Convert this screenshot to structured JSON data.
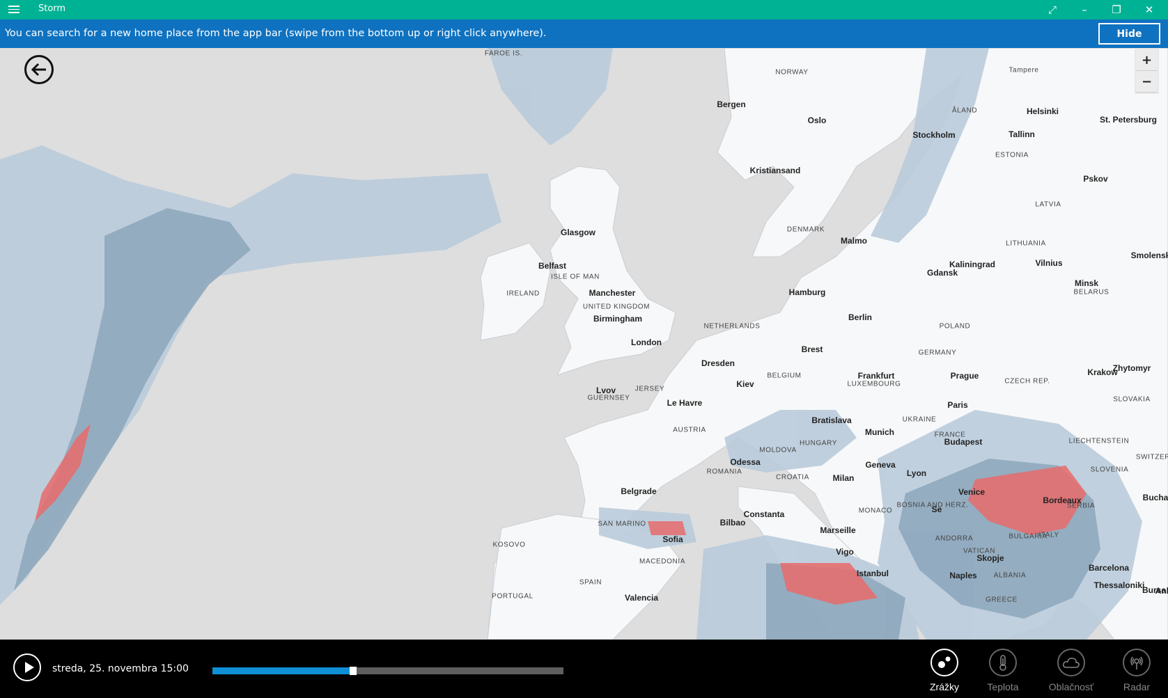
{
  "app": {
    "title": "Storm"
  },
  "banner": {
    "message": "You can search for a new home place from the app bar (swipe from the bottom up or right click anywhere).",
    "hide_label": "Hide"
  },
  "map": {
    "labels": [
      {
        "text": "FAROE IS.",
        "kind": "country"
      },
      {
        "text": "NORWAY",
        "kind": "country"
      },
      {
        "text": "Bergen",
        "kind": "city"
      },
      {
        "text": "Oslo",
        "kind": "city"
      },
      {
        "text": "Stockholm",
        "kind": "city"
      },
      {
        "text": "Tampere",
        "kind": "country"
      },
      {
        "text": "ÅLAND",
        "kind": "country"
      },
      {
        "text": "Helsinki",
        "kind": "city"
      },
      {
        "text": "St. Petersburg",
        "kind": "city"
      },
      {
        "text": "Tallinn",
        "kind": "city"
      },
      {
        "text": "ESTONIA",
        "kind": "country"
      },
      {
        "text": "Kristiansand",
        "kind": "city"
      },
      {
        "text": "Pskov",
        "kind": "city"
      },
      {
        "text": "LATVIA",
        "kind": "country"
      },
      {
        "text": "DENMARK",
        "kind": "country"
      },
      {
        "text": "Malmo",
        "kind": "city"
      },
      {
        "text": "LITHUANIA",
        "kind": "country"
      },
      {
        "text": "Kaliningrad",
        "kind": "city"
      },
      {
        "text": "Vilnius",
        "kind": "city"
      },
      {
        "text": "Smolensk",
        "kind": "city"
      },
      {
        "text": "Gdansk",
        "kind": "city"
      },
      {
        "text": "Glasgow",
        "kind": "city"
      },
      {
        "text": "Belfast",
        "kind": "city"
      },
      {
        "text": "ISLE OF MAN",
        "kind": "country"
      },
      {
        "text": "IRELAND",
        "kind": "country"
      },
      {
        "text": "Manchester",
        "kind": "city"
      },
      {
        "text": "UNITED KINGDOM",
        "kind": "country"
      },
      {
        "text": "Birmingham",
        "kind": "city"
      },
      {
        "text": "London",
        "kind": "city"
      },
      {
        "text": "Hamburg",
        "kind": "city"
      },
      {
        "text": "Berlin",
        "kind": "city"
      },
      {
        "text": "Minsk",
        "kind": "city"
      },
      {
        "text": "BELARUS",
        "kind": "country"
      },
      {
        "text": "NETHERLANDS",
        "kind": "country"
      },
      {
        "text": "POLAND",
        "kind": "country"
      },
      {
        "text": "Brest",
        "kind": "city"
      },
      {
        "text": "GERMANY",
        "kind": "country"
      },
      {
        "text": "Dresden",
        "kind": "city"
      },
      {
        "text": "BELGIUM",
        "kind": "country"
      },
      {
        "text": "Frankfurt",
        "kind": "city"
      },
      {
        "text": "Prague",
        "kind": "city"
      },
      {
        "text": "Krakow",
        "kind": "city"
      },
      {
        "text": "Zhytomyr",
        "kind": "city"
      },
      {
        "text": "Kiev",
        "kind": "city"
      },
      {
        "text": "LUXEMBOURG",
        "kind": "country"
      },
      {
        "text": "CZECH REP.",
        "kind": "country"
      },
      {
        "text": "Lvov",
        "kind": "city"
      },
      {
        "text": "GUERNSEY",
        "kind": "country"
      },
      {
        "text": "JERSEY",
        "kind": "country"
      },
      {
        "text": "Le Havre",
        "kind": "city"
      },
      {
        "text": "Paris",
        "kind": "city"
      },
      {
        "text": "SLOVAKIA",
        "kind": "country"
      },
      {
        "text": "UKRAINE",
        "kind": "country"
      },
      {
        "text": "Bratislava",
        "kind": "city"
      },
      {
        "text": "Munich",
        "kind": "city"
      },
      {
        "text": "AUSTRIA",
        "kind": "country"
      },
      {
        "text": "FRANCE",
        "kind": "country"
      },
      {
        "text": "Budapest",
        "kind": "city"
      },
      {
        "text": "HUNGARY",
        "kind": "country"
      },
      {
        "text": "LIECHTENSTEIN",
        "kind": "country"
      },
      {
        "text": "MOLDOVA",
        "kind": "country"
      },
      {
        "text": "SWITZERLAND",
        "kind": "country"
      },
      {
        "text": "Odessa",
        "kind": "city"
      },
      {
        "text": "Geneva",
        "kind": "city"
      },
      {
        "text": "SLOVENIA",
        "kind": "country"
      },
      {
        "text": "ROMANIA",
        "kind": "country"
      },
      {
        "text": "Lyon",
        "kind": "city"
      },
      {
        "text": "CROATIA",
        "kind": "country"
      },
      {
        "text": "Milan",
        "kind": "city"
      },
      {
        "text": "Venice",
        "kind": "city"
      },
      {
        "text": "Belgrade",
        "kind": "city"
      },
      {
        "text": "Bordeaux",
        "kind": "city"
      },
      {
        "text": "Bucharest",
        "kind": "city"
      },
      {
        "text": "Se",
        "kind": "city"
      },
      {
        "text": "BOSNIA AND HERZ.",
        "kind": "country"
      },
      {
        "text": "SERBIA",
        "kind": "country"
      },
      {
        "text": "Constanta",
        "kind": "city"
      },
      {
        "text": "MONACO",
        "kind": "country"
      },
      {
        "text": "SAN MARINO",
        "kind": "country"
      },
      {
        "text": "Bilbao",
        "kind": "city"
      },
      {
        "text": "Marseille",
        "kind": "city"
      },
      {
        "text": "ITALY",
        "kind": "country"
      },
      {
        "text": "BULGARIA",
        "kind": "country"
      },
      {
        "text": "Sofia",
        "kind": "city"
      },
      {
        "text": "ANDORRA",
        "kind": "country"
      },
      {
        "text": "KOSOVO",
        "kind": "country"
      },
      {
        "text": "Vigo",
        "kind": "city"
      },
      {
        "text": "VATICAN",
        "kind": "country"
      },
      {
        "text": "Skopje",
        "kind": "city"
      },
      {
        "text": "MACEDONIA",
        "kind": "country"
      },
      {
        "text": "Barcelona",
        "kind": "city"
      },
      {
        "text": "Istanbul",
        "kind": "city"
      },
      {
        "text": "Naples",
        "kind": "city"
      },
      {
        "text": "ALBANIA",
        "kind": "country"
      },
      {
        "text": "Thessaloniki",
        "kind": "city"
      },
      {
        "text": "Bursa",
        "kind": "city"
      },
      {
        "text": "SPAIN",
        "kind": "country"
      },
      {
        "text": "Ank",
        "kind": "city"
      },
      {
        "text": "PORTUGAL",
        "kind": "country"
      },
      {
        "text": "Valencia",
        "kind": "city"
      },
      {
        "text": "GREECE",
        "kind": "country"
      }
    ],
    "zoom_in": "+",
    "zoom_out": "−"
  },
  "player": {
    "datetime": "streda, 25. novembra 15:00",
    "progress": 0.4
  },
  "nav": [
    {
      "label": "Zrážky",
      "icon": "precipitation-icon",
      "active": true
    },
    {
      "label": "Teplota",
      "icon": "thermometer-icon",
      "active": false
    },
    {
      "label": "Oblačnosť",
      "icon": "cloud-icon",
      "active": false
    },
    {
      "label": "Radar",
      "icon": "radar-icon",
      "active": false
    }
  ],
  "colors": {
    "titlebar": "#00b294",
    "banner": "#0f72c0",
    "sea": "#dedede",
    "land": "#f7f8f9",
    "precip_light": "#b9cbda",
    "precip_mid": "#8fa8bd",
    "precip_heavy": "#e76b6b",
    "timeline_fill": "#0f8fd6"
  }
}
